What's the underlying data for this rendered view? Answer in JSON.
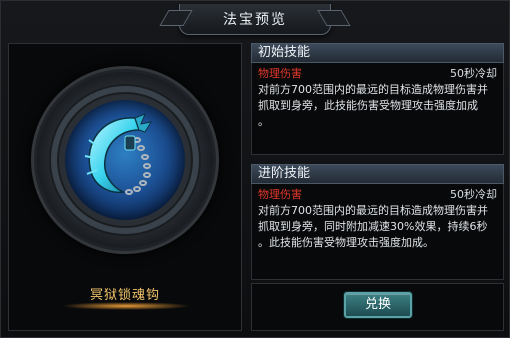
{
  "window": {
    "title": "法宝预览"
  },
  "preview": {
    "item_name": "冥狱锁魂钩",
    "icon": "chain-hook-weapon-icon"
  },
  "skills": [
    {
      "header": "初始技能",
      "damage_type": "物理伤害",
      "cooldown": "50秒冷却",
      "description_lines": [
        "对前方700范围内的最远的目标造成物理伤害并",
        "抓取到身旁，此技能伤害受物理攻击强度加成",
        "。"
      ]
    },
    {
      "header": "进阶技能",
      "damage_type": "物理伤害",
      "cooldown": "50秒冷却",
      "description_lines": [
        "对前方700范围内的最远的目标造成物理伤害并",
        "抓取到身旁，同时附加减速30%效果，持续6秒",
        "。此技能伤害受物理攻击强度加成。"
      ]
    }
  ],
  "actions": {
    "exchange_label": "兑换"
  },
  "colors": {
    "damage_text": "#e3382a",
    "item_name": "#f0c36a",
    "button": "#2e6a6f"
  }
}
